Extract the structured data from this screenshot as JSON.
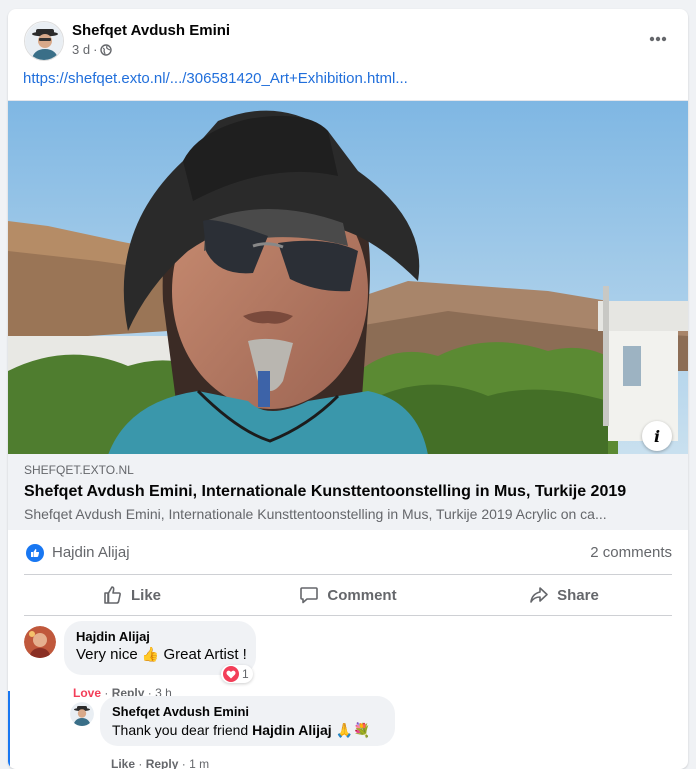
{
  "post": {
    "author": "Shefqet Avdush Emini",
    "time": "3 d",
    "link_text": "https://shefqet.exto.nl/.../306581420_Art+Exhibition.html...",
    "preview": {
      "domain": "SHEFQET.EXTO.NL",
      "title": "Shefqet Avdush Emini, Internationale Kunsttentoonstelling in Mus, Turkije 2019",
      "description": "Shefqet Avdush Emini, Internationale Kunsttentoonstelling in Mus, Turkije 2019   Acrylic on ca..."
    },
    "reactions": {
      "name": "Hajdin Alijaj",
      "comments": "2 comments"
    },
    "actions": {
      "like": "Like",
      "comment": "Comment",
      "share": "Share"
    }
  },
  "comments": [
    {
      "author": "Hajdin Alijaj",
      "text": "Very nice",
      "emoji": "👍",
      "text2": "Great Artist !",
      "reaction": "Love",
      "reply": "Reply",
      "time": "3 h",
      "reaction_count": "1"
    },
    {
      "author": "Shefqet Avdush Emini",
      "text": "Thank you dear friend",
      "mention": "Hajdin Alijaj",
      "emoji": "🙏💐",
      "like": "Like",
      "reply": "Reply",
      "time": "1 m"
    }
  ],
  "colors": {
    "accent": "#1877f2",
    "link": "#216fdb",
    "love": "#f33e58",
    "muted": "#65676b"
  },
  "icons": [
    "more-icon",
    "globe-icon",
    "info-icon",
    "like-badge-icon",
    "thumb-up-icon",
    "comment-icon",
    "share-icon",
    "heart-icon"
  ]
}
